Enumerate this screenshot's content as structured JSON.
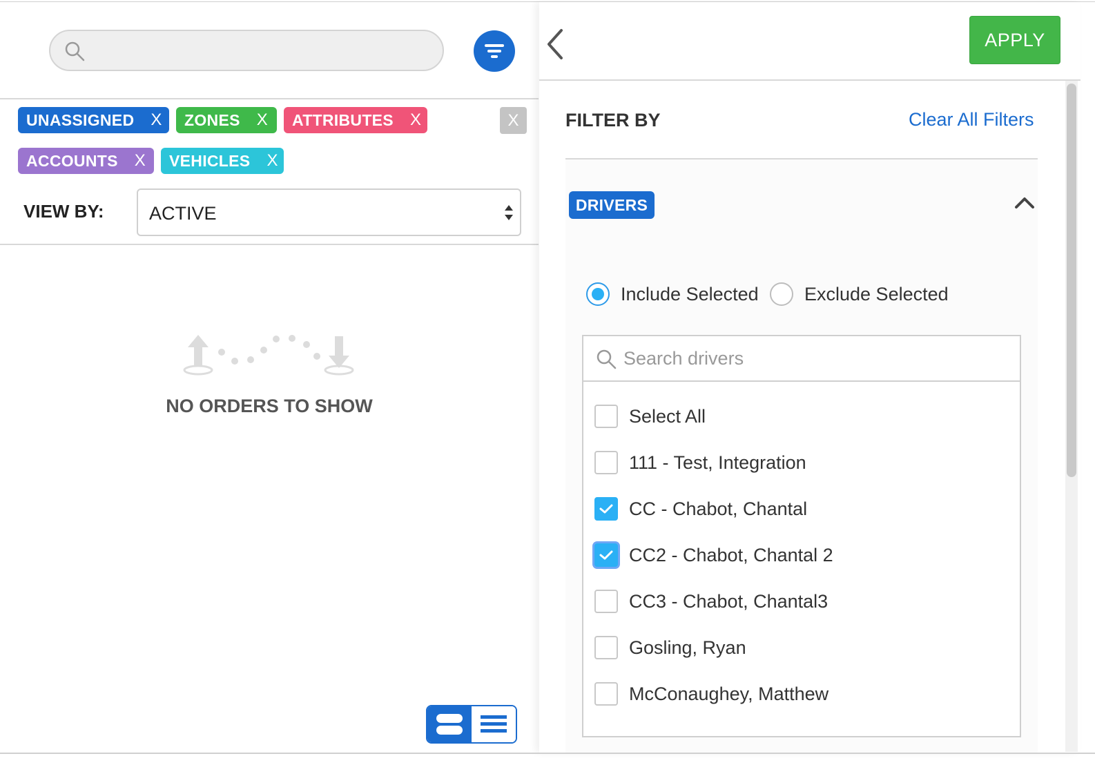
{
  "search": {
    "placeholder": ""
  },
  "chips": {
    "unassigned": "UNASSIGNED",
    "zones": "ZONES",
    "attributes": "ATTRIBUTES",
    "accounts": "ACCOUNTS",
    "vehicles": "VEHICLES",
    "remove": "X",
    "clear_all": "X"
  },
  "view_by": {
    "label": "VIEW BY:",
    "value": "ACTIVE"
  },
  "empty_state": "NO ORDERS TO SHOW",
  "filter_panel": {
    "apply": "APPLY",
    "filter_by": "FILTER BY",
    "clear_all": "Clear All Filters",
    "section": "DRIVERS",
    "include": "Include Selected",
    "exclude": "Exclude Selected",
    "include_selected": true,
    "search_placeholder": "Search drivers",
    "drivers": [
      {
        "label": "Select All",
        "checked": false
      },
      {
        "label": "111 - Test, Integration",
        "checked": false
      },
      {
        "label": "CC - Chabot, Chantal",
        "checked": true
      },
      {
        "label": "CC2 - Chabot, Chantal 2",
        "checked": true,
        "focused": true
      },
      {
        "label": "CC3 - Chabot, Chantal3",
        "checked": false
      },
      {
        "label": "Gosling, Ryan",
        "checked": false
      },
      {
        "label": "McConaughey, Matthew",
        "checked": false
      }
    ]
  },
  "colors": {
    "primary": "#1b6ccf",
    "apply": "#43b649",
    "zones": "#3fb94a",
    "attributes": "#f05478",
    "accounts": "#9b75cf",
    "vehicles": "#2cc5d9",
    "checkbox": "#2ab0f5"
  }
}
